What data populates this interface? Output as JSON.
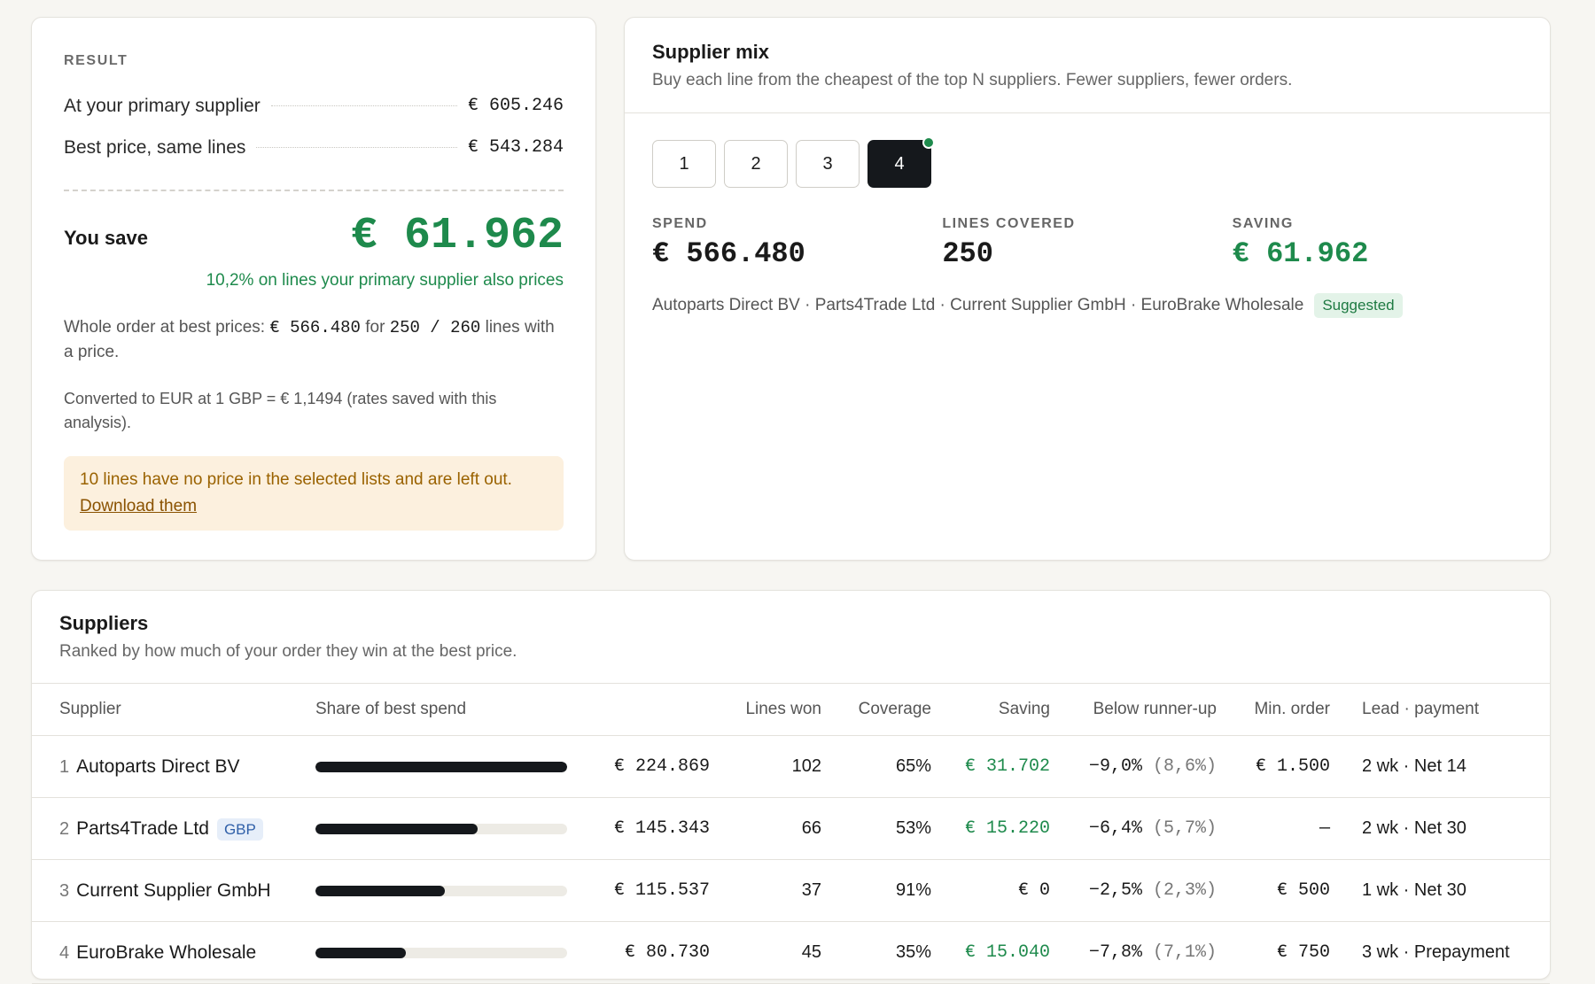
{
  "result": {
    "eyebrow": "RESULT",
    "primary_label": "At your primary supplier",
    "primary_value": "€ 605.246",
    "best_label": "Best price, same lines",
    "best_value": "€ 543.284",
    "save_label": "You save",
    "save_value": "€ 61.962",
    "save_note": "10,2% on lines your primary supplier also prices",
    "whole_order_prefix": "Whole order at best prices:",
    "whole_order_amount": "€ 566.480",
    "whole_order_for": "for",
    "whole_order_lines": "250 / 260",
    "whole_order_suffix": "lines with a price.",
    "conversion_note": "Converted to EUR at 1 GBP = € 1,1494 (rates saved with this analysis).",
    "warning_text": "10 lines have no price in the selected lists and are left out.",
    "warning_link": "Download them"
  },
  "mix": {
    "title": "Supplier mix",
    "subtitle": "Buy each line from the cheapest of the top N suppliers. Fewer suppliers, fewer orders.",
    "buttons": [
      "1",
      "2",
      "3",
      "4"
    ],
    "active_index": 3,
    "spend_label": "SPEND",
    "spend_value": "€ 566.480",
    "lines_label": "LINES COVERED",
    "lines_value": "250",
    "saving_label": "SAVING",
    "saving_value": "€ 61.962",
    "supplier_list": "Autoparts Direct BV · Parts4Trade Ltd · Current Supplier GmbH · EuroBrake Wholesale",
    "suggested_badge": "Suggested"
  },
  "suppliers": {
    "title": "Suppliers",
    "subtitle": "Ranked by how much of your order they win at the best price.",
    "columns": {
      "supplier": "Supplier",
      "share": "Share of best spend",
      "lines_won": "Lines won",
      "coverage": "Coverage",
      "saving": "Saving",
      "below": "Below runner-up",
      "min_order": "Min. order",
      "lead": "Lead · payment"
    },
    "rows": [
      {
        "rank": "1",
        "name": "Autoparts Direct BV",
        "tag": "",
        "share": 1.0,
        "spend": "€ 224.869",
        "lines_won": "102",
        "coverage": "65%",
        "saving": "€ 31.702",
        "saving_positive": true,
        "below": "−9,0%",
        "below_alt": "(8,6%)",
        "min_order": "€ 1.500",
        "lead": "2 wk · Net 14"
      },
      {
        "rank": "2",
        "name": "Parts4Trade Ltd",
        "tag": "GBP",
        "share": 0.646,
        "spend": "€ 145.343",
        "lines_won": "66",
        "coverage": "53%",
        "saving": "€ 15.220",
        "saving_positive": true,
        "below": "−6,4%",
        "below_alt": "(5,7%)",
        "min_order": "—",
        "lead": "2 wk · Net 30"
      },
      {
        "rank": "3",
        "name": "Current Supplier GmbH",
        "tag": "",
        "share": 0.514,
        "spend": "€ 115.537",
        "lines_won": "37",
        "coverage": "91%",
        "saving": "€ 0",
        "saving_positive": false,
        "below": "−2,5%",
        "below_alt": "(2,3%)",
        "min_order": "€ 500",
        "lead": "1 wk · Net 30"
      },
      {
        "rank": "4",
        "name": "EuroBrake Wholesale",
        "tag": "",
        "share": 0.359,
        "spend": "€ 80.730",
        "lines_won": "45",
        "coverage": "35%",
        "saving": "€ 15.040",
        "saving_positive": true,
        "below": "−7,8%",
        "below_alt": "(7,1%)",
        "min_order": "€ 750",
        "lead": "3 wk · Prepayment"
      }
    ]
  }
}
